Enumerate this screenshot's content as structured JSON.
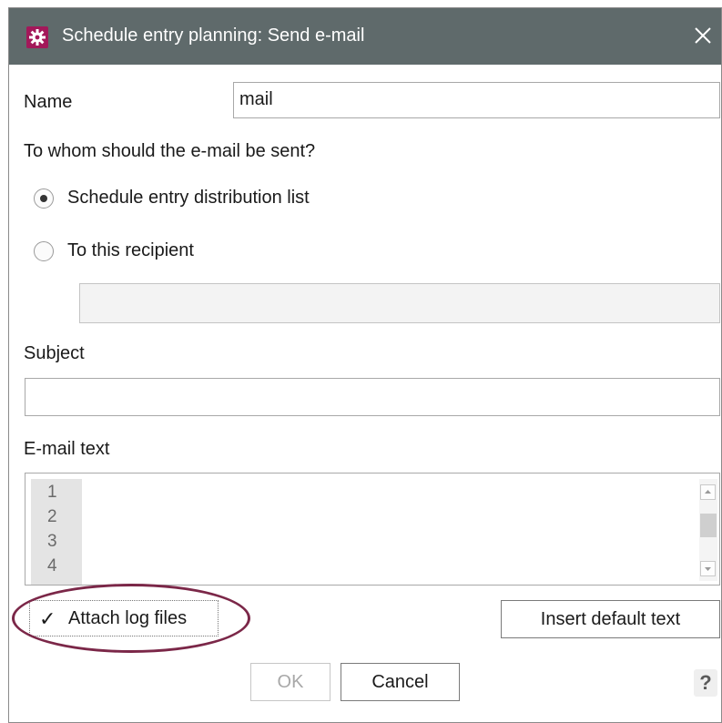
{
  "window": {
    "title": "Schedule entry planning: Send e-mail",
    "icon": "gear-icon",
    "close_icon": "close-icon",
    "accent_color": "#a3185a",
    "titlebar_color": "#5f6a6b"
  },
  "form": {
    "name_label": "Name",
    "name_value": "mail",
    "recipient_question": "To whom should the e-mail be sent?",
    "radio_distribution_label": "Schedule entry distribution list",
    "radio_distribution_selected": true,
    "radio_recipient_label": "To this recipient",
    "radio_recipient_selected": false,
    "recipient_value": "",
    "subject_label": "Subject",
    "subject_value": "",
    "email_text_label": "E-mail text",
    "line_numbers": [
      "1",
      "2",
      "3",
      "4"
    ]
  },
  "options": {
    "attach_logs_label": "Attach log files",
    "attach_logs_checked": true,
    "check_glyph": "✓",
    "highlight_color": "#7b2748"
  },
  "buttons": {
    "insert_default_label": "Insert default text",
    "ok_label": "OK",
    "ok_enabled": false,
    "cancel_label": "Cancel",
    "help_label": "?"
  }
}
